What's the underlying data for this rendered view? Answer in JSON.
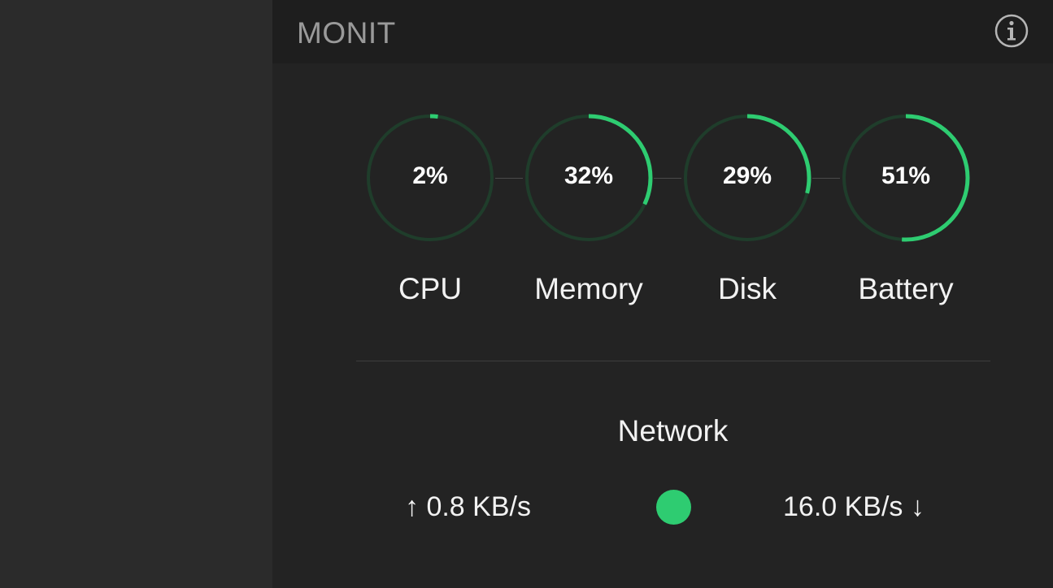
{
  "app": {
    "title": "MONIT",
    "info_icon": "info-circle-icon"
  },
  "colors": {
    "accent": "#2ecc71",
    "track": "#1f3d2b",
    "background": "#232323",
    "header": "#1e1e1e"
  },
  "gauges": [
    {
      "id": "cpu",
      "label": "CPU",
      "value_text": "2%",
      "fraction": 0.02
    },
    {
      "id": "memory",
      "label": "Memory",
      "value_text": "32%",
      "fraction": 0.32
    },
    {
      "id": "disk",
      "label": "Disk",
      "value_text": "29%",
      "fraction": 0.29
    },
    {
      "id": "battery",
      "label": "Battery",
      "value_text": "51%",
      "fraction": 0.51
    }
  ],
  "network": {
    "title": "Network",
    "upload": "↑ 0.8 KB/s",
    "download": "16.0 KB/s ↓",
    "status_indicator": "network-status-dot"
  }
}
